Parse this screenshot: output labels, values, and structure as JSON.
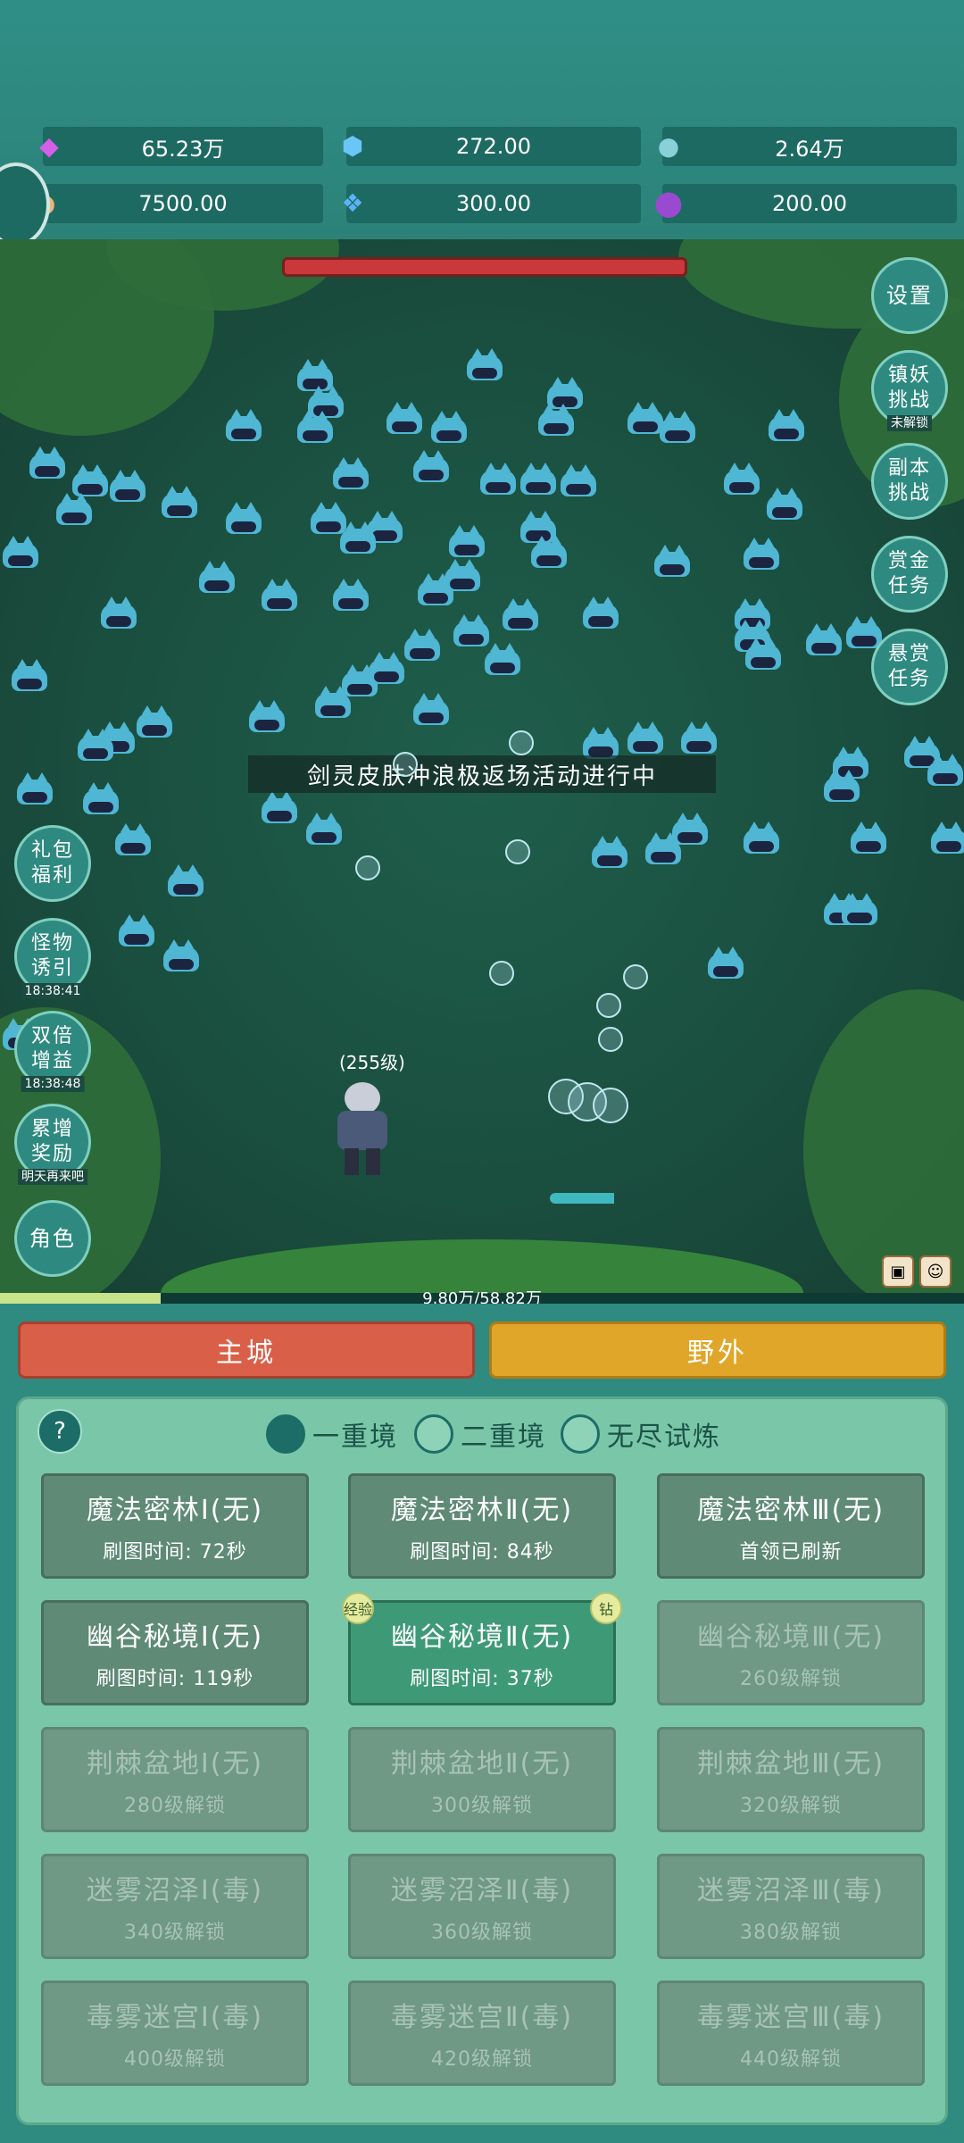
{
  "resources": [
    {
      "icon": "diamond-icon",
      "value": "65.23万",
      "color": "#c84fe0"
    },
    {
      "icon": "crystal-icon",
      "value": "272.00",
      "color": "#5ab8f0"
    },
    {
      "icon": "orb-icon",
      "value": "2.64万",
      "color": "#6fc0c8"
    },
    {
      "icon": "horn-icon",
      "value": "7500.00",
      "color": "#e0b070"
    },
    {
      "icon": "ice-gem-icon",
      "value": "300.00",
      "color": "#4aa8f0"
    },
    {
      "icon": "potion-icon",
      "value": "200.00",
      "color": "#8a3bbf"
    }
  ],
  "field": {
    "banner": "剑灵皮肤冲浪极返场活动进行中",
    "hero_level": "(255级)"
  },
  "right_buttons": [
    {
      "label": "设置",
      "sub": ""
    },
    {
      "label": "镇妖挑战",
      "sub": "未解锁"
    },
    {
      "label": "副本挑战",
      "sub": ""
    },
    {
      "label": "赏金任务",
      "sub": ""
    },
    {
      "label": "悬赏任务",
      "sub": ""
    }
  ],
  "left_buttons": [
    {
      "label": "礼包福利",
      "sub": ""
    },
    {
      "label": "怪物诱引",
      "sub": "18:38:41"
    },
    {
      "label": "双倍增益",
      "sub": "18:38:48"
    },
    {
      "label": "累增奖励",
      "sub": "明天再来吧"
    },
    {
      "label": "角色",
      "sub": ""
    }
  ],
  "xp": {
    "text": "9.80万/58.82万",
    "progress": 0.167
  },
  "tabs": {
    "main_city": "主城",
    "wild": "野外"
  },
  "help": "?",
  "modes": [
    {
      "label": "一重境",
      "selected": true
    },
    {
      "label": "二重境",
      "selected": false
    },
    {
      "label": "无尽试炼",
      "selected": false
    }
  ],
  "cards": [
    {
      "title": "魔法密林Ⅰ(无)",
      "sub": "刷图时间: 72秒",
      "state": "open"
    },
    {
      "title": "魔法密林Ⅱ(无)",
      "sub": "刷图时间: 84秒",
      "state": "open"
    },
    {
      "title": "魔法密林Ⅲ(无)",
      "sub": "首领已刷新",
      "state": "open"
    },
    {
      "title": "幽谷秘境Ⅰ(无)",
      "sub": "刷图时间: 119秒",
      "state": "open"
    },
    {
      "title": "幽谷秘境Ⅱ(无)",
      "sub": "刷图时间: 37秒",
      "state": "selected",
      "tag_left": "经验",
      "tag_right": "钻"
    },
    {
      "title": "幽谷秘境Ⅲ(无)",
      "sub": "260级解锁",
      "state": "locked"
    },
    {
      "title": "荆棘盆地Ⅰ(无)",
      "sub": "280级解锁",
      "state": "locked"
    },
    {
      "title": "荆棘盆地Ⅱ(无)",
      "sub": "300级解锁",
      "state": "locked"
    },
    {
      "title": "荆棘盆地Ⅲ(无)",
      "sub": "320级解锁",
      "state": "locked"
    },
    {
      "title": "迷雾沼泽Ⅰ(毒)",
      "sub": "340级解锁",
      "state": "locked"
    },
    {
      "title": "迷雾沼泽Ⅱ(毒)",
      "sub": "360级解锁",
      "state": "locked"
    },
    {
      "title": "迷雾沼泽Ⅲ(毒)",
      "sub": "380级解锁",
      "state": "locked"
    },
    {
      "title": "毒雾迷宫Ⅰ(毒)",
      "sub": "400级解锁",
      "state": "locked"
    },
    {
      "title": "毒雾迷宫Ⅱ(毒)",
      "sub": "420级解锁",
      "state": "locked"
    },
    {
      "title": "毒雾迷宫Ⅲ(毒)",
      "sub": "440级解锁",
      "state": "locked"
    }
  ]
}
